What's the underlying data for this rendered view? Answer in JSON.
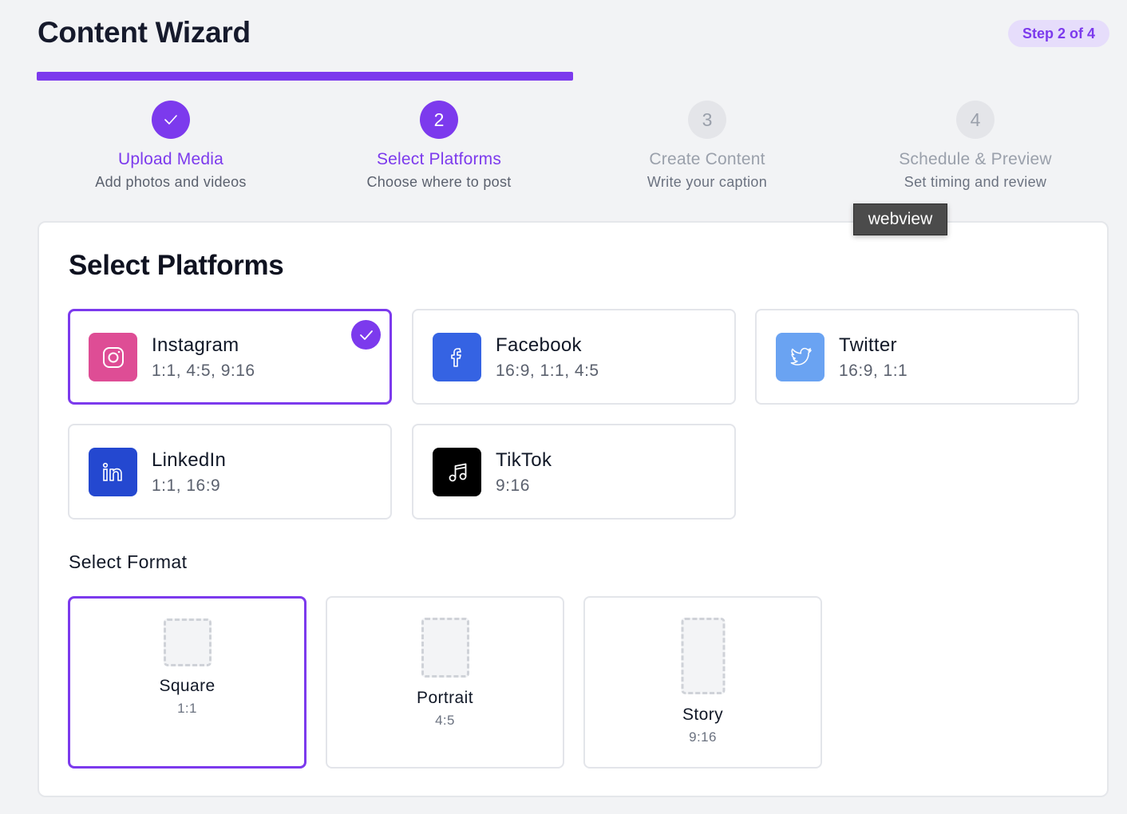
{
  "app": {
    "title": "Content Wizard",
    "step_badge": "Step 2 of 4"
  },
  "progress": {
    "fraction": 0.5
  },
  "steps": [
    {
      "number": "1",
      "label": "Upload Media",
      "description": "Add photos and videos",
      "state": "complete"
    },
    {
      "number": "2",
      "label": "Select Platforms",
      "description": "Choose where to post",
      "state": "active"
    },
    {
      "number": "3",
      "label": "Create Content",
      "description": "Write your caption",
      "state": "upcoming"
    },
    {
      "number": "4",
      "label": "Schedule & Preview",
      "description": "Set timing and review",
      "state": "upcoming"
    }
  ],
  "panel": {
    "title": "Select Platforms",
    "format_heading": "Select Format"
  },
  "platforms": [
    {
      "name": "Instagram",
      "ratios": "1:1, 4:5, 9:16",
      "icon": "instagram-icon",
      "color": "#de4d95",
      "selected": true
    },
    {
      "name": "Facebook",
      "ratios": "16:9, 1:1, 4:5",
      "icon": "facebook-icon",
      "color": "#3563e3",
      "selected": false
    },
    {
      "name": "Twitter",
      "ratios": "16:9, 1:1",
      "icon": "twitter-icon",
      "color": "#6aa3f2",
      "selected": false
    },
    {
      "name": "LinkedIn",
      "ratios": "1:1, 16:9",
      "icon": "linkedin-icon",
      "color": "#2448d0",
      "selected": false
    },
    {
      "name": "TikTok",
      "ratios": "9:16",
      "icon": "tiktok-icon",
      "color": "#000000",
      "selected": false
    }
  ],
  "formats": [
    {
      "name": "Square",
      "ratio": "1:1",
      "selected": true
    },
    {
      "name": "Portrait",
      "ratio": "4:5",
      "selected": false
    },
    {
      "name": "Story",
      "ratio": "9:16",
      "selected": false
    }
  ],
  "tooltip": {
    "text": "webview"
  },
  "colors": {
    "accent": "#7c3aed",
    "badge_bg": "#e6ddfb",
    "upcoming": "#9aa0ab"
  }
}
